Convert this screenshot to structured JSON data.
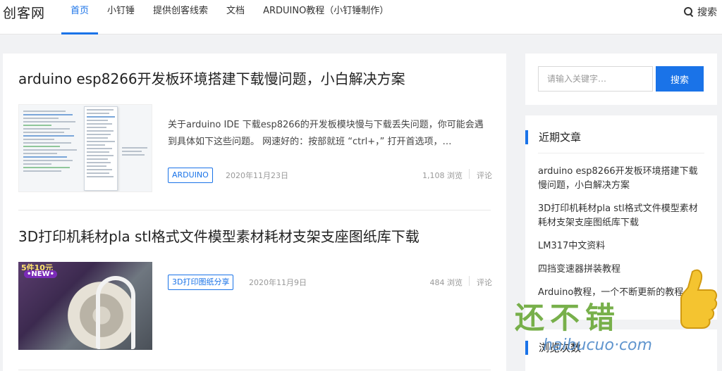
{
  "header": {
    "logo": "创客网",
    "nav": [
      "首页",
      "小钉锤",
      "提供创客线索",
      "文档",
      "ARDUINO教程（小钉锤制作）"
    ],
    "active_nav": 0,
    "search_label": "搜索"
  },
  "posts": [
    {
      "title": "arduino esp8266开发板环境搭建下载慢问题，小白解决方案",
      "excerpt": "关于arduino IDE 下载esp8266的开发板模块慢与下载丢失问题，你可能会遇到具体如下这些问题。 网速好的：按部就班 “ctrl+，” 打开首选项，…",
      "tag": "ARDUINO",
      "date": "2020年11月23日",
      "views": "1,108 浏览",
      "comments": "评论"
    },
    {
      "title": "3D打印机耗材pla stl格式文件模型素材耗材支架支座图纸库下载",
      "excerpt": "",
      "tag": "3D打印图纸分享",
      "date": "2020年11月9日",
      "views": "484 浏览",
      "comments": "评论",
      "thumb_badge": "5件10元",
      "thumb_badge_2": "•NEW•"
    }
  ],
  "sidebar": {
    "search_placeholder": "请输入关键字…",
    "search_button": "搜索",
    "recent_title": "近期文章",
    "recent_posts": [
      "arduino esp8266开发板环境搭建下载慢问题，小白解决方案",
      "3D打印机耗材pla stl格式文件模型素材耗材支架支座图纸库下载",
      "LM317中文资料",
      "四挡变速器拼装教程",
      "Arduino教程，一个不断更新的教程"
    ],
    "views_title": "浏览次数"
  },
  "watermark": {
    "text": "还不错",
    "url": "haibucuo·com"
  },
  "colors": {
    "accent": "#1a73e8",
    "watermark_green": "#6aa838",
    "watermark_blue": "#4f8ac9"
  }
}
